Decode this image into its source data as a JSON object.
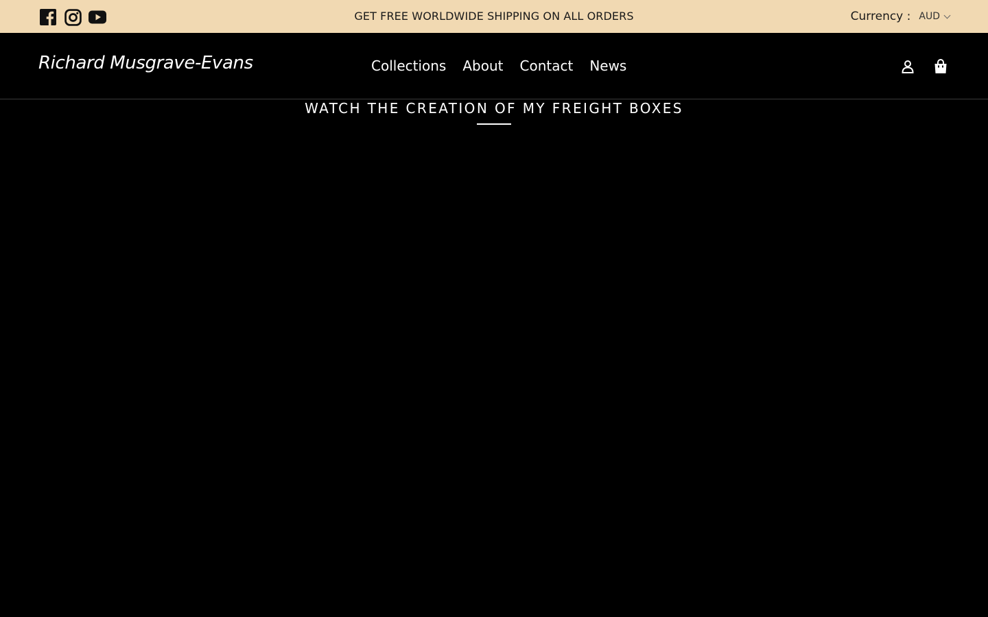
{
  "announcement": {
    "text": "GET FREE WORLDWIDE SHIPPING ON ALL ORDERS",
    "currency_label": "Currency :",
    "currency_value": "AUD",
    "background_color": "#f1d9b2"
  },
  "social": {
    "icons": [
      "facebook-icon",
      "instagram-icon",
      "youtube-icon"
    ]
  },
  "header": {
    "logo": "Richard Musgrave-Evans",
    "nav": {
      "collections": "Collections",
      "about": "About",
      "contact": "Contact",
      "news": "News"
    },
    "icons": [
      "account-icon",
      "cart-icon"
    ]
  },
  "section": {
    "title": "WATCH THE CREATION OF MY FREIGHT BOXES"
  }
}
